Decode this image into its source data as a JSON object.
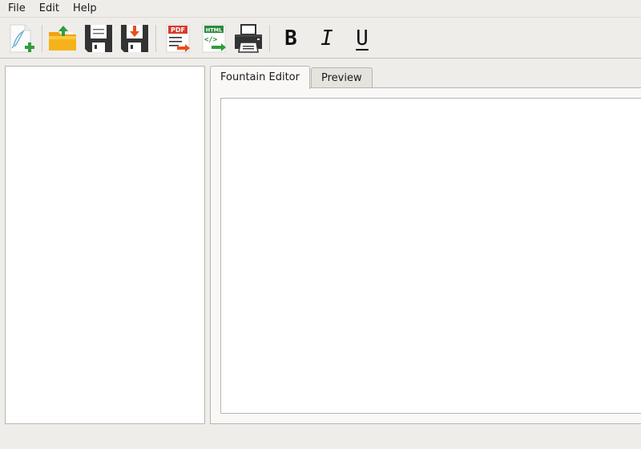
{
  "menu": {
    "file": "File",
    "edit": "Edit",
    "help": "Help"
  },
  "toolbar": {
    "icons": [
      "new-document-icon",
      "open-folder-icon",
      "save-icon",
      "save-as-icon",
      "export-pdf-icon",
      "export-html-icon",
      "print-icon",
      "bold-icon",
      "italic-icon",
      "underline-icon"
    ],
    "pdf_badge": "PDF",
    "html_badge": "HTML",
    "bold_label": "B",
    "italic_label": "I",
    "underline_label": "U"
  },
  "tabs": {
    "editor": "Fountain Editor",
    "preview": "Preview",
    "active": "editor"
  },
  "colors": {
    "background": "#efedea",
    "panel": "#ffffff",
    "border": "#b9b5ae",
    "accent_green": "#2e9e3a",
    "accent_orange": "#e8501e",
    "folder_yellow": "#f6b21b",
    "pdf_red": "#d63a2a",
    "html_green": "#2a8a3a"
  }
}
